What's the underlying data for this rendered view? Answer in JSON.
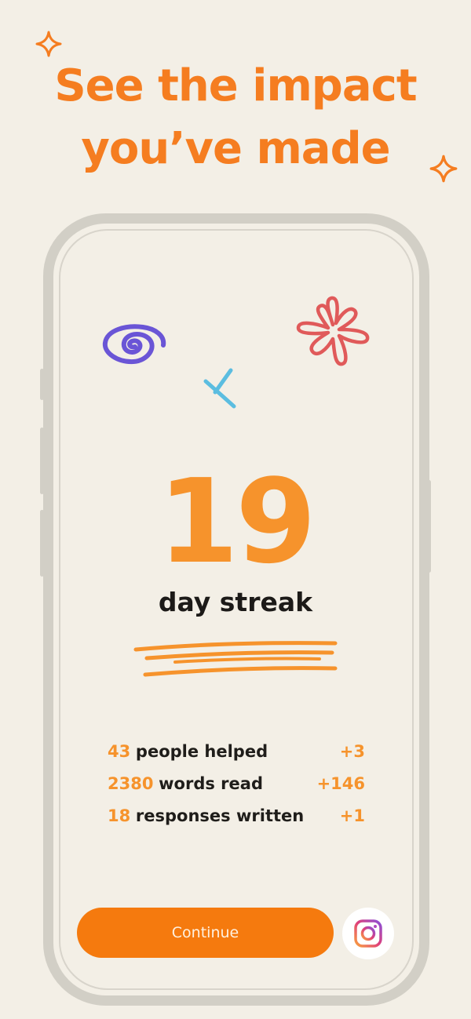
{
  "headline": {
    "line1": "See the impact",
    "line2": "you’ve made"
  },
  "streak": {
    "count": "19",
    "label": "day streak"
  },
  "stats": [
    {
      "value": "43",
      "label": "people helped",
      "delta": "+3"
    },
    {
      "value": "2380",
      "label": "words read",
      "delta": "+146"
    },
    {
      "value": "18",
      "label": "responses written",
      "delta": "+1"
    }
  ],
  "actions": {
    "continue_label": "Continue",
    "share_icon": "instagram-icon"
  },
  "colors": {
    "accent": "#f57d20",
    "background": "#f3efe6",
    "swirl": "#6a55d6",
    "cross": "#5bbde0",
    "flower": "#e05a5a"
  }
}
